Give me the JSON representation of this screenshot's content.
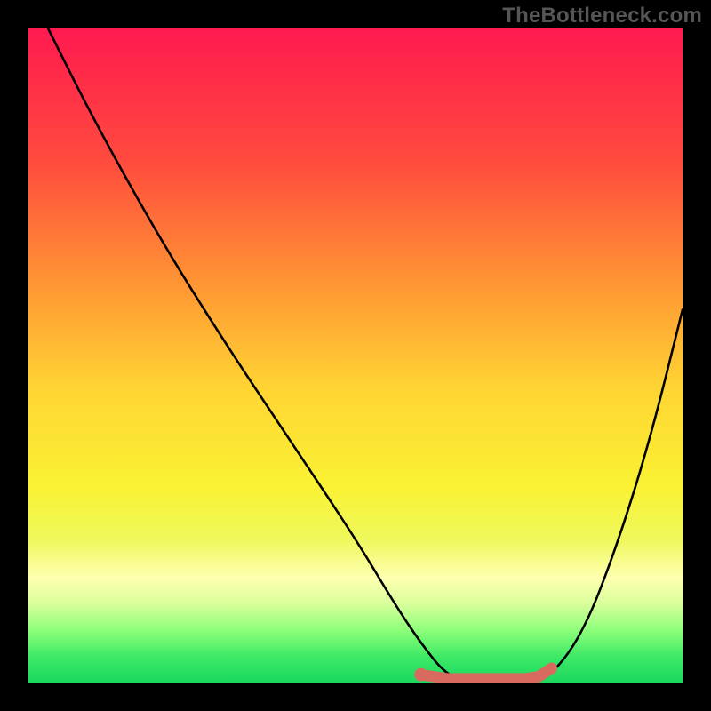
{
  "attribution": "TheBottleneck.com",
  "chart_data": {
    "type": "line",
    "title": "",
    "xlabel": "",
    "ylabel": "",
    "xlim": [
      0,
      100
    ],
    "ylim": [
      0,
      100
    ],
    "series": [
      {
        "name": "bottleneck-curve",
        "x": [
          3,
          10,
          20,
          30,
          40,
          50,
          56,
          60,
          64,
          68,
          72,
          76,
          80,
          85,
          90,
          95,
          100
        ],
        "values": [
          100,
          86,
          68,
          52,
          37,
          22,
          12,
          6,
          1,
          0,
          0,
          0,
          1,
          8,
          21,
          37,
          57
        ]
      },
      {
        "name": "optimal-band-marker",
        "x": [
          60,
          64,
          68,
          72,
          76,
          78,
          80
        ],
        "values": [
          1.2,
          0.6,
          0.6,
          0.6,
          0.6,
          0.9,
          2.2
        ]
      }
    ],
    "background_gradient": {
      "stops": [
        {
          "pct": 0,
          "color": "#ff1a4f"
        },
        {
          "pct": 20,
          "color": "#ff4a3e"
        },
        {
          "pct": 40,
          "color": "#ff9933"
        },
        {
          "pct": 55,
          "color": "#ffd433"
        },
        {
          "pct": 70,
          "color": "#faf233"
        },
        {
          "pct": 78,
          "color": "#eef85a"
        },
        {
          "pct": 84,
          "color": "#ffffb0"
        },
        {
          "pct": 88,
          "color": "#d8ff9a"
        },
        {
          "pct": 92,
          "color": "#8dff7a"
        },
        {
          "pct": 96,
          "color": "#3eea66"
        },
        {
          "pct": 100,
          "color": "#1bd85e"
        }
      ]
    },
    "marker_color": "#d86a60",
    "curve_color": "#000000"
  }
}
